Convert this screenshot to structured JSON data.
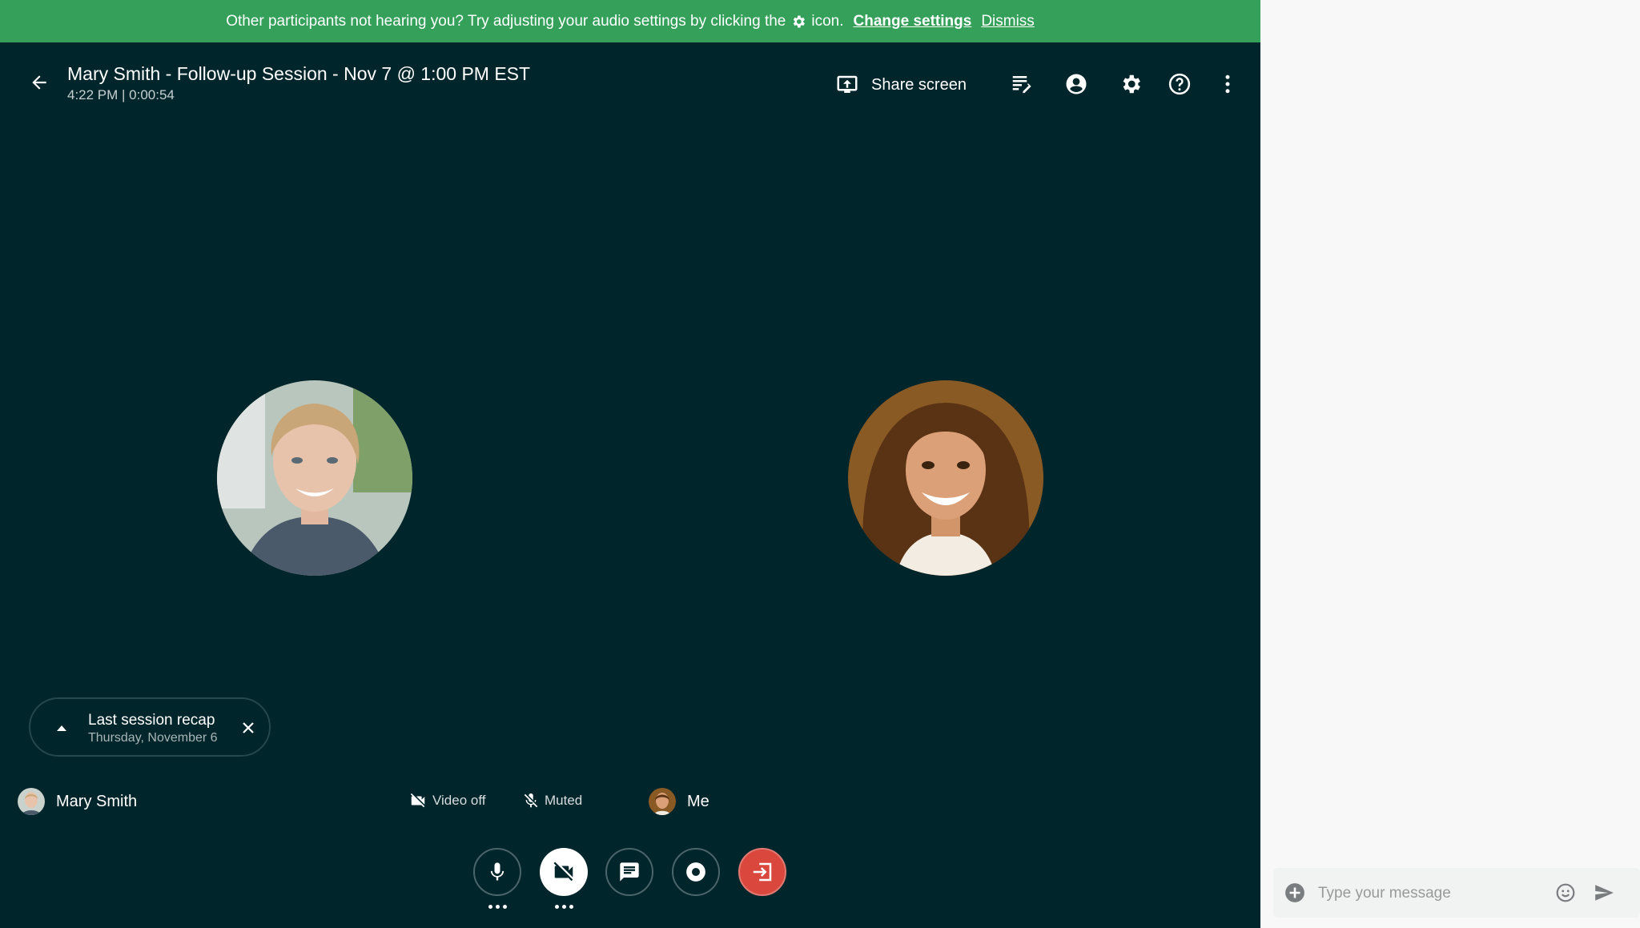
{
  "banner": {
    "text_before": "Other participants not hearing you? Try adjusting your audio settings by clicking the",
    "text_after": "icon.",
    "change_settings": "Change settings",
    "dismiss": "Dismiss",
    "background": "#34a05a"
  },
  "header": {
    "title": "Mary Smith - Follow-up Session - Nov 7 @ 1:00 PM EST",
    "subtitle": "4:22 PM | 0:00:54",
    "share_screen": "Share screen",
    "icons": [
      "notes-icon",
      "account-icon",
      "settings-icon",
      "help-icon",
      "more-vert-icon"
    ]
  },
  "recap": {
    "title": "Last session recap",
    "date": "Thursday, November 6"
  },
  "participants": {
    "left_name": "Mary Smith",
    "video_status": "Video off",
    "mic_status": "Muted",
    "right_name": "Me"
  },
  "controls": [
    "mic-icon",
    "video-off-icon",
    "chat-icon",
    "record-icon",
    "leave-icon"
  ],
  "chat": {
    "placeholder": "Type your message"
  },
  "colors": {
    "background": "#00252b",
    "leave_button": "#d9473d",
    "sidebar": "#f7f8f7"
  }
}
